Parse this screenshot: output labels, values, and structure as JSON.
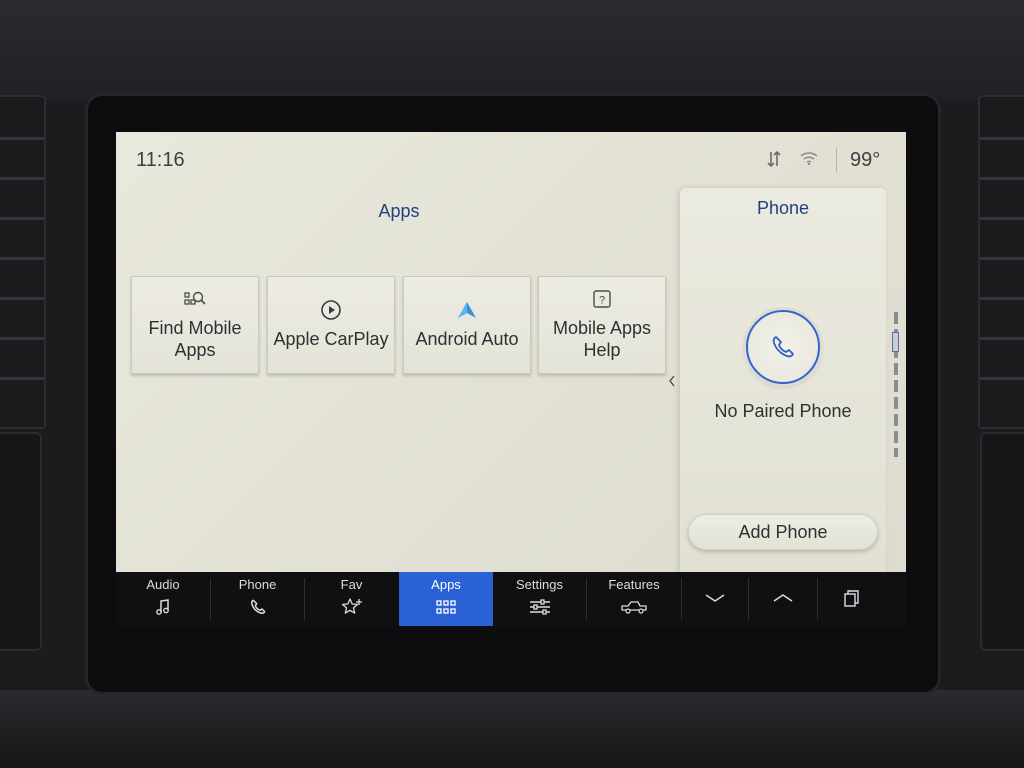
{
  "status_bar": {
    "time": "11:16",
    "temperature": "99°"
  },
  "apps": {
    "title": "Apps",
    "tiles": [
      {
        "label": "Find Mobile Apps",
        "icon": "search-apps-icon"
      },
      {
        "label": "Apple CarPlay",
        "icon": "carplay-icon"
      },
      {
        "label": "Android Auto",
        "icon": "android-auto-icon"
      },
      {
        "label": "Mobile Apps Help",
        "icon": "help-icon"
      }
    ]
  },
  "phone_panel": {
    "title": "Phone",
    "status": "No Paired Phone",
    "add_button": "Add Phone",
    "icon": "phone-icon"
  },
  "nav": {
    "items": [
      {
        "label": "Audio",
        "icon": "music-note-icon"
      },
      {
        "label": "Phone",
        "icon": "phone-icon"
      },
      {
        "label": "Fav",
        "icon": "star-plus-icon"
      },
      {
        "label": "Apps",
        "icon": "apps-grid-icon",
        "active": true
      },
      {
        "label": "Settings",
        "icon": "sliders-icon"
      },
      {
        "label": "Features",
        "icon": "truck-icon"
      }
    ],
    "extra_icons": [
      "chevron-down-icon",
      "chevron-up-icon",
      "copy-windows-icon"
    ]
  },
  "colors": {
    "accent_blue": "#2a62d6",
    "title_blue": "#23407f",
    "screen_bg": "#e6e5da"
  }
}
